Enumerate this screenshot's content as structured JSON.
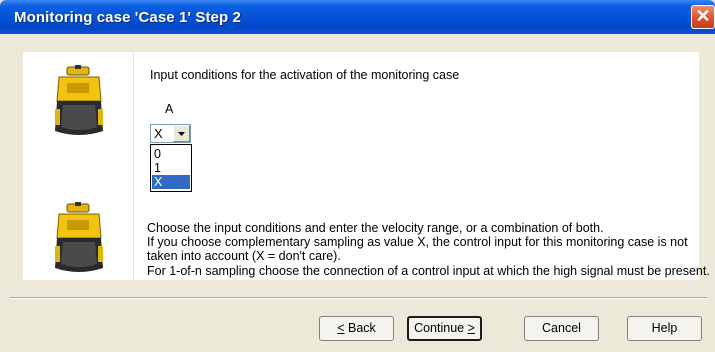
{
  "window": {
    "title": "Monitoring case 'Case 1' Step 2",
    "close_icon": "close-icon"
  },
  "content": {
    "heading": "Input conditions for the activation of the monitoring case",
    "column_label": "A",
    "combo": {
      "value": "X",
      "arrow_icon": "chevron-down-icon"
    },
    "options": [
      "0",
      "1",
      "X"
    ],
    "selected_option": "X",
    "help_lines": [
      "Choose the input conditions and enter the velocity range, or a combination of both.",
      "If you choose complementary sampling as value X, the control input for this monitoring case is not",
      "taken into account (X = don't care).",
      "For 1-of-n sampling choose the connection of a control input at which the high signal must be present."
    ]
  },
  "images": [
    "safety-laser-scanner-image",
    "safety-laser-scanner-image"
  ],
  "buttons": {
    "back": {
      "underlined": "<",
      "rest": " Back"
    },
    "continue": {
      "text": "Continue ",
      "underlined": ">"
    },
    "cancel": "Cancel",
    "help": "Help"
  },
  "colors": {
    "titlebar": "#0450d6",
    "dialog_bg": "#ece9d8",
    "selection": "#316ac5",
    "close_button": "#d8502a",
    "device_yellow": "#f3c311"
  }
}
